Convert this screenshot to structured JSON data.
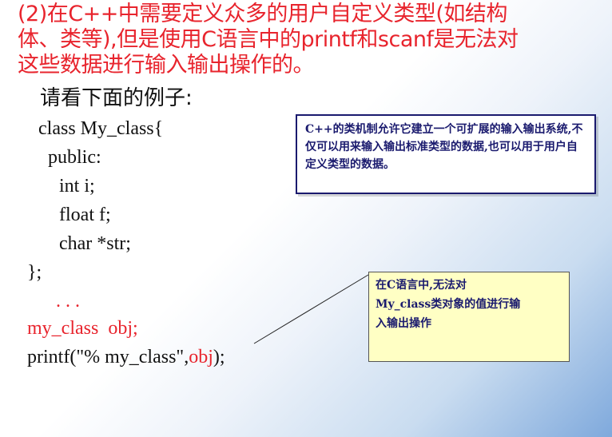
{
  "heading": {
    "line1": "  (2)在C++中需要定义众多的用户自定义类型(如结构",
    "line2": "体、类等),但是使用C语言中的printf和scanf是无法对",
    "line3": "这些数据进行输入输出操作的。"
  },
  "intro": "请看下面的例子:",
  "code": {
    "l1": "class My_class{",
    "l2": "public:",
    "l3": "int i;",
    "l4": "float f;",
    "l5": "char *str;",
    "l6": "};",
    "l7": ". . .",
    "l8": "my_class  obj;",
    "l9a": "printf(\"% my_class\",",
    "l9b": "obj",
    "l9c": ");"
  },
  "callout1": {
    "text": "      C++的类机制允许它建立一个可扩展的输入输出系统,不仅可以用来输入输出标准类型的数据,也可以用于用户自定义类型的数据。"
  },
  "callout2": {
    "line1": "  在C语言中,无法对",
    "line2": "My_class类对象的值进行输",
    "line3": "入输出操作"
  }
}
